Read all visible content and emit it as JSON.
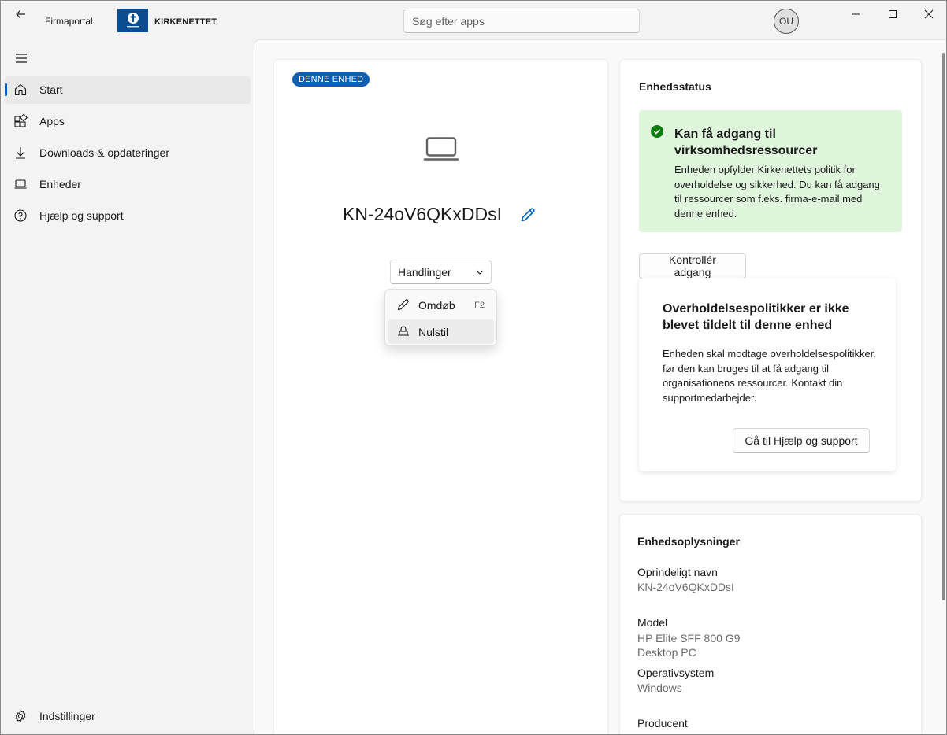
{
  "titlebar": {
    "app_name": "Firmaportal",
    "org_name": "KIRKENETTET",
    "search_placeholder": "Søg efter apps",
    "avatar_initials": "OU"
  },
  "sidebar": {
    "items": [
      {
        "label": "Start",
        "icon": "home-icon",
        "active": true
      },
      {
        "label": "Apps",
        "icon": "apps-icon"
      },
      {
        "label": "Downloads & opdateringer",
        "icon": "download-icon"
      },
      {
        "label": "Enheder",
        "icon": "laptop-icon"
      },
      {
        "label": "Hjælp og support",
        "icon": "help-icon"
      }
    ],
    "settings_label": "Indstillinger"
  },
  "device": {
    "badge": "DENNE ENHED",
    "name": "KN-24oV6QKxDDsI",
    "actions_label": "Handlinger",
    "menu": [
      {
        "label": "Omdøb",
        "shortcut": "F2",
        "icon": "pencil-icon"
      },
      {
        "label": "Nulstil",
        "icon": "reset-icon"
      }
    ]
  },
  "status": {
    "heading": "Enhedsstatus",
    "title": "Kan få adgang til virksomhedsressourcer",
    "text": "Enheden opfylder Kirkenettets politik for overholdelse og sikkerhed. Du kan få adgang til ressourcer som f.eks. firma-e-mail med denne enhed.",
    "check_button": "Kontrollér adgang",
    "policy_title": "Overholdelsespolitikker er ikke blevet tildelt til denne enhed",
    "policy_text": "Enheden skal modtage overholdelsespolitikker, før den kan bruges til at få adgang til organisationens ressourcer. Kontakt din supportmedarbejder.",
    "help_button": "Gå til Hjælp og support",
    "colors": {
      "success_bg": "#dff6dd",
      "success_icon": "#0f7b0f",
      "accent": "#005fb8"
    }
  },
  "info": {
    "heading": "Enhedsoplysninger",
    "original_name_label": "Oprindeligt navn",
    "original_name_value": "KN-24oV6QKxDDsI",
    "model_label": "Model",
    "model_value": "HP Elite SFF 800 G9",
    "model_type": "Desktop PC",
    "os_label": "Operativsystem",
    "os_value": "Windows",
    "producer_label": "Producent"
  }
}
